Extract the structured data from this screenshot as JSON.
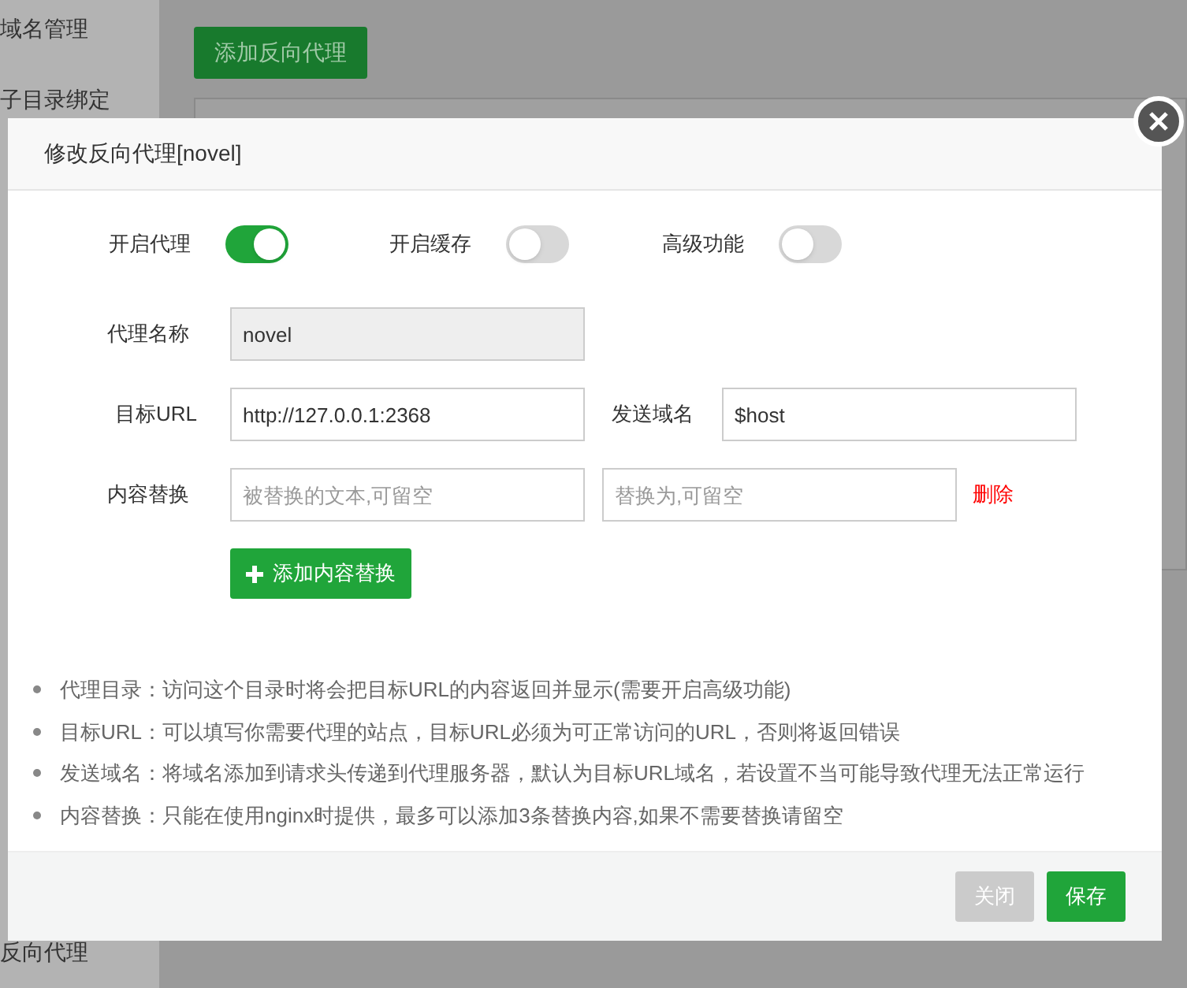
{
  "sidebar": {
    "items": [
      {
        "label": "域名管理"
      },
      {
        "label": "子目录绑定"
      },
      {
        "label": "反向代理"
      }
    ]
  },
  "main": {
    "add_button": "添加反向代理"
  },
  "dialog": {
    "title": "修改反向代理[novel]",
    "toggles": [
      {
        "label": "开启代理",
        "on": true
      },
      {
        "label": "开启缓存",
        "on": false
      },
      {
        "label": "高级功能",
        "on": false
      }
    ],
    "name_field": {
      "label": "代理名称",
      "value": "novel",
      "disabled": true
    },
    "target_field": {
      "label": "目标URL",
      "value": "http://127.0.0.1:2368"
    },
    "host_field": {
      "label": "发送域名",
      "value": "$host"
    },
    "replace_row": {
      "label": "内容替换",
      "from_placeholder": "被替换的文本,可留空",
      "to_placeholder": "替换为,可留空",
      "delete_link": "删除"
    },
    "add_replace_button": "添加内容替换",
    "notes": [
      "代理目录：访问这个目录时将会把目标URL的内容返回并显示(需要开启高级功能)",
      "目标URL：可以填写你需要代理的站点，目标URL必须为可正常访问的URL，否则将返回错误",
      "发送域名：将域名添加到请求头传递到代理服务器，默认为目标URL域名，若设置不当可能导致代理无法正常运行",
      "内容替换：只能在使用nginx时提供，最多可以添加3条替换内容,如果不需要替换请留空"
    ],
    "buttons": [
      {
        "label": "关闭",
        "kind": "secondary"
      },
      {
        "label": "保存",
        "kind": "primary"
      }
    ]
  }
}
